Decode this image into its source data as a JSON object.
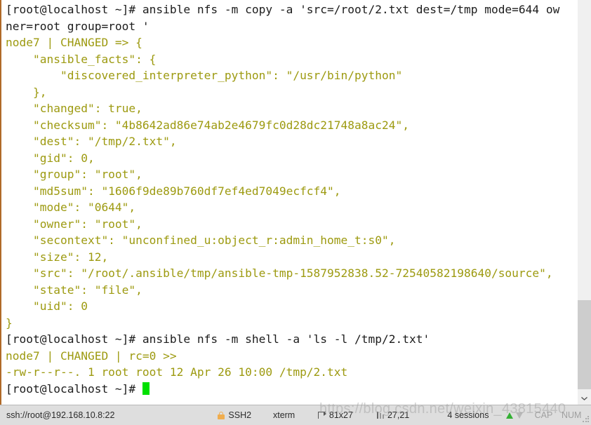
{
  "terminal": {
    "lines": [
      {
        "text": "[root@localhost ~]# ansible nfs -m copy -a 'src=/root/2.txt dest=/tmp mode=644 ow",
        "style": "prompt"
      },
      {
        "text": "ner=root group=root '",
        "style": "prompt"
      },
      {
        "text": "node7 | CHANGED => {",
        "style": "out"
      },
      {
        "text": "    \"ansible_facts\": {",
        "style": "out"
      },
      {
        "text": "        \"discovered_interpreter_python\": \"/usr/bin/python\"",
        "style": "out"
      },
      {
        "text": "    },",
        "style": "out"
      },
      {
        "text": "    \"changed\": true,",
        "style": "out"
      },
      {
        "text": "    \"checksum\": \"4b8642ad86e74ab2e4679fc0d28dc21748a8ac24\",",
        "style": "out"
      },
      {
        "text": "    \"dest\": \"/tmp/2.txt\",",
        "style": "out"
      },
      {
        "text": "    \"gid\": 0,",
        "style": "out"
      },
      {
        "text": "    \"group\": \"root\",",
        "style": "out"
      },
      {
        "text": "    \"md5sum\": \"1606f9de89b760df7ef4ed7049ecfcf4\",",
        "style": "out"
      },
      {
        "text": "    \"mode\": \"0644\",",
        "style": "out"
      },
      {
        "text": "    \"owner\": \"root\",",
        "style": "out"
      },
      {
        "text": "    \"secontext\": \"unconfined_u:object_r:admin_home_t:s0\",",
        "style": "out"
      },
      {
        "text": "    \"size\": 12,",
        "style": "out"
      },
      {
        "text": "    \"src\": \"/root/.ansible/tmp/ansible-tmp-1587952838.52-72540582198640/source\",",
        "style": "out"
      },
      {
        "text": "    \"state\": \"file\",",
        "style": "out"
      },
      {
        "text": "    \"uid\": 0",
        "style": "out"
      },
      {
        "text": "}",
        "style": "out"
      },
      {
        "text": "[root@localhost ~]# ansible nfs -m shell -a 'ls -l /tmp/2.txt'",
        "style": "prompt"
      },
      {
        "text": "node7 | CHANGED | rc=0 >>",
        "style": "out"
      },
      {
        "text": "-rw-r--r--. 1 root root 12 Apr 26 10:00 /tmp/2.txt",
        "style": "out"
      },
      {
        "text": "[root@localhost ~]# ",
        "style": "prompt",
        "cursor": true
      }
    ],
    "colors": {
      "background": "#ffffff",
      "prompt_text": "#1c1c1c",
      "output_text": "#9d9a10",
      "cursor": "#00e000",
      "left_border": "#b06a28"
    }
  },
  "scrollbar": {
    "down_button_icon": "chevron-down-icon"
  },
  "statusbar": {
    "connection": "ssh://root@192.168.10.8:22",
    "security_icon": "lock-icon",
    "protocol": "SSH2",
    "terminal_type": "xterm",
    "size_icon": "terminal-size-icon",
    "size": "81x27",
    "position_icon": "cursor-position-icon",
    "position": "27,21",
    "sessions": "4 sessions",
    "upload_icon": "arrow-up-icon",
    "download_icon": "arrow-down-icon",
    "caps_lock": "CAP",
    "num_lock": "NUM"
  },
  "watermark": {
    "text": "https://blog.csdn.net/weixin_43815440"
  }
}
